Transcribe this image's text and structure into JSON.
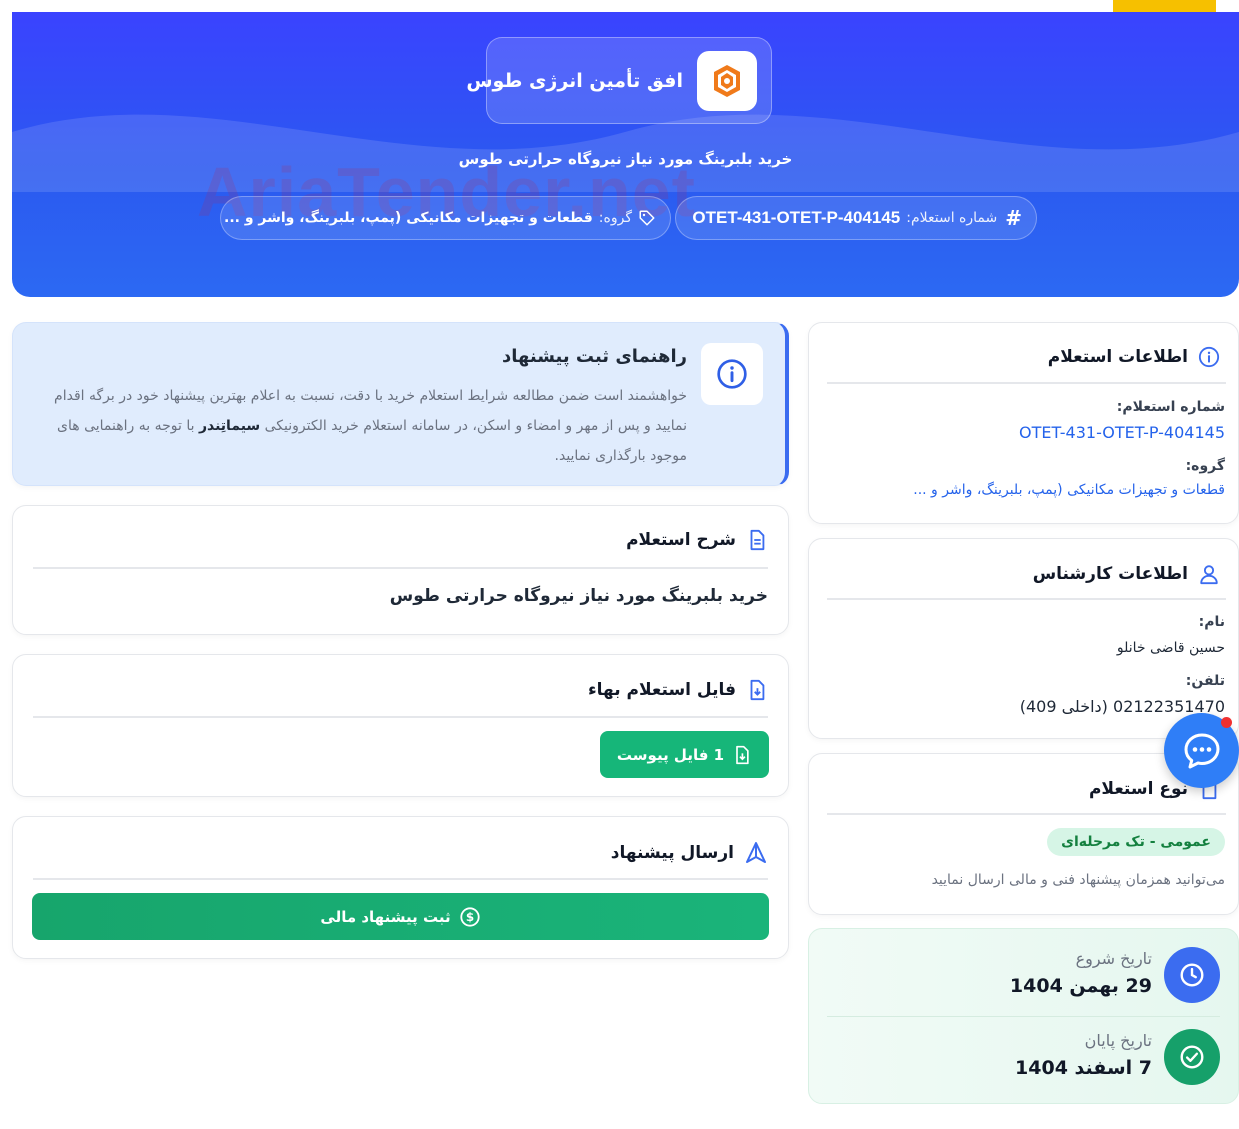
{
  "header": {
    "company_name": "افق تأمین انرژی طوس",
    "title": "خرید بلبرینگ مورد نیاز نیروگاه حرارتی طوس",
    "inquiry_number_label": "شماره استعلام:",
    "inquiry_number": "OTET-431-OTET-P-404145",
    "group_label": "گروه:",
    "group_value": "قطعات و تجهیزات مکانیکی (پمپ، بلبرینگ، واشر و ...",
    "watermark": "AriaTender.net"
  },
  "guide": {
    "title": "راهنمای ثبت پیشنهاد",
    "text_part1": "خواهشمند است ضمن مطالعه شرایط استعلام خرید با دقت، نسبت به اعلام بهترین پیشنهاد خود در برگه اقدام نمایید و پس از مهر و امضاء و اسکن، در سامانه استعلام خرید الکترونیکی ",
    "text_bold": "سیماتِندر",
    "text_part2": " با توجه به راهنمایی های موجود بارگذاری نمایید."
  },
  "description": {
    "title": "شرح استعلام",
    "text": "خرید بلبرینگ مورد نیاز نیروگاه حرارتی طوس"
  },
  "file": {
    "title": "فایل استعلام بهاء",
    "button_label": "1 فایل پیوست"
  },
  "send": {
    "title": "ارسال پیشنهاد",
    "button_label": "ثبت پیشنهاد مالی"
  },
  "inquiry_info": {
    "title": "اطلاعات استعلام",
    "number_label": "شماره استعلام:",
    "number_value": "OTET-431-OTET-P-404145",
    "group_label": "گروه:",
    "group_value": "قطعات و تجهیزات مکانیکی (پمپ، بلبرینگ، واشر و ..."
  },
  "expert": {
    "title": "اطلاعات کارشناس",
    "name_label": "نام:",
    "name_value": "حسین قاضی خانلو",
    "phone_label": "تلفن:",
    "phone_value": "02122351470 (داخلی 409)"
  },
  "inquiry_type": {
    "title": "نوع استعلام",
    "badge": "عمومی - تک مرحله‌ای",
    "note": "می‌توانید همزمان پیشنهاد فنی و مالی ارسال نمایید"
  },
  "dates": {
    "start_label": "تاریخ شروع",
    "start_value": "29 بهمن 1404",
    "end_label": "تاریخ پایان",
    "end_value": "7 اسفند 1404"
  },
  "colors": {
    "hero": "#2b59f0",
    "accent_green": "#16b679",
    "link_blue": "#2563eb",
    "clock_circle": "#3b6cf0",
    "check_circle": "#16a06a"
  }
}
